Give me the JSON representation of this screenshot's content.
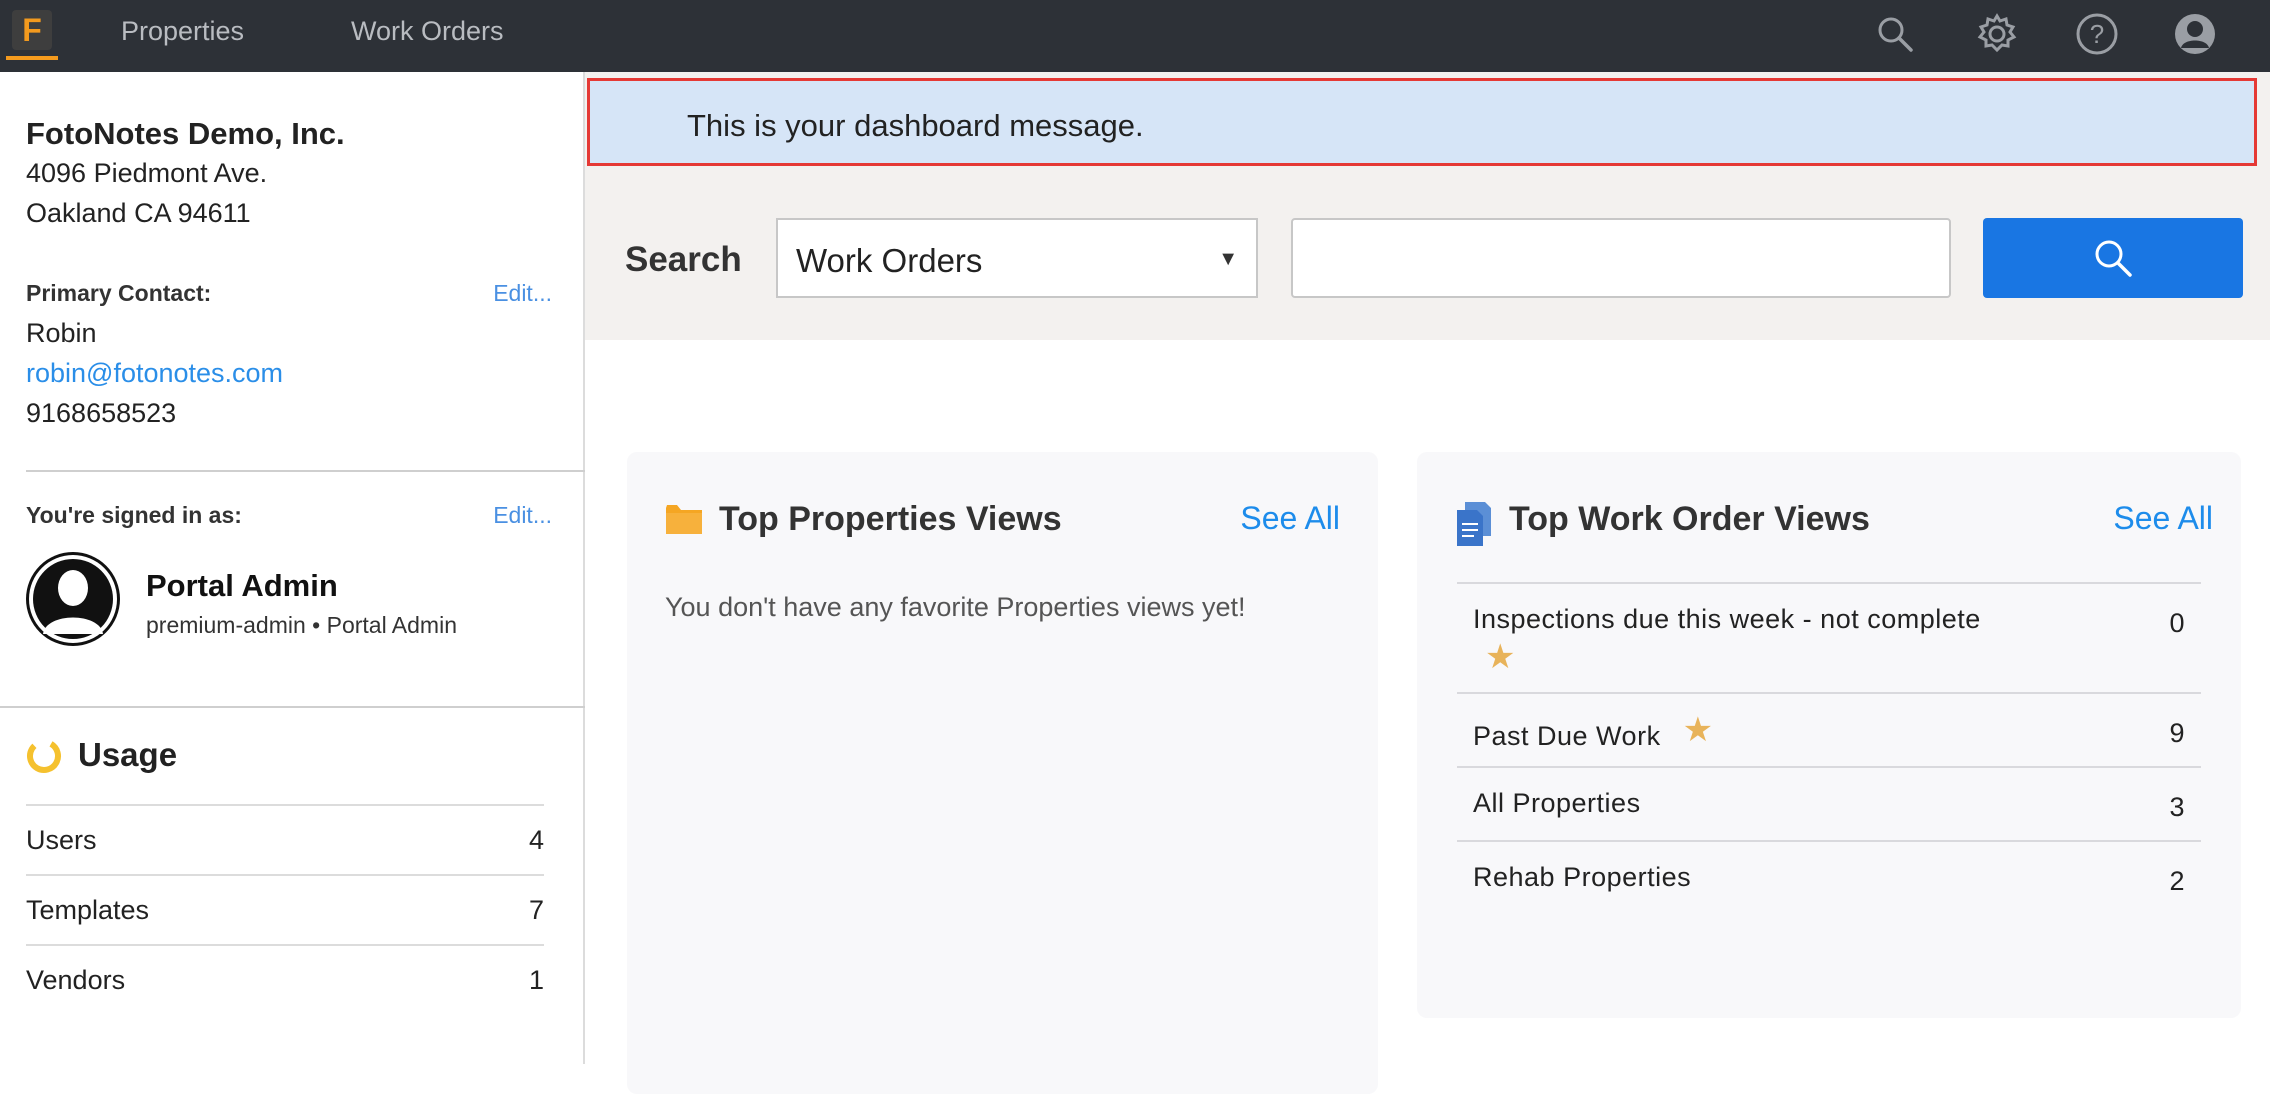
{
  "nav": {
    "logo_letter": "F",
    "items": [
      {
        "label": "Properties"
      },
      {
        "label": "Work Orders"
      }
    ],
    "icons": [
      "search-icon",
      "gear-icon",
      "help-icon",
      "user-icon"
    ]
  },
  "sidebar": {
    "company": {
      "name": "FotoNotes Demo, Inc.",
      "address_line1": "4096 Piedmont Ave.",
      "address_line2": "Oakland CA 94611"
    },
    "primary_contact": {
      "label": "Primary Contact:",
      "edit_label": "Edit...",
      "name": "Robin",
      "email": "robin@fotonotes.com",
      "phone": "9168658523"
    },
    "signed_in": {
      "label": "You're signed in as:",
      "edit_label": "Edit...",
      "user_name": "Portal Admin",
      "user_role": "premium-admin • Portal Admin"
    },
    "usage": {
      "title": "Usage",
      "items": [
        {
          "label": "Users",
          "value": "4"
        },
        {
          "label": "Templates",
          "value": "7"
        },
        {
          "label": "Vendors",
          "value": "1"
        }
      ]
    }
  },
  "main": {
    "dashboard_message": "This is your dashboard message.",
    "search": {
      "label": "Search",
      "selected": "Work Orders",
      "input_value": ""
    },
    "top_properties": {
      "title": "Top Properties Views",
      "see_all": "See All",
      "empty_message": "You don't have any favorite Properties views yet!"
    },
    "top_work_orders": {
      "title": "Top Work Order Views",
      "see_all": "See All",
      "rows": [
        {
          "name": "Inspections due this week - not complete",
          "count": "0",
          "starred": true
        },
        {
          "name": "Past Due Work",
          "count": "9",
          "starred": true
        },
        {
          "name": "All Properties",
          "count": "3",
          "starred": false
        },
        {
          "name": "Rehab Properties",
          "count": "2",
          "starred": false
        }
      ]
    }
  },
  "colors": {
    "topbar": "#2d3137",
    "accent_orange": "#f39a1e",
    "link_blue": "#1d8ceb",
    "button_blue": "#1976e3",
    "message_bg": "#d6e5f7",
    "message_border": "#e53935",
    "star": "#e8b35a"
  }
}
